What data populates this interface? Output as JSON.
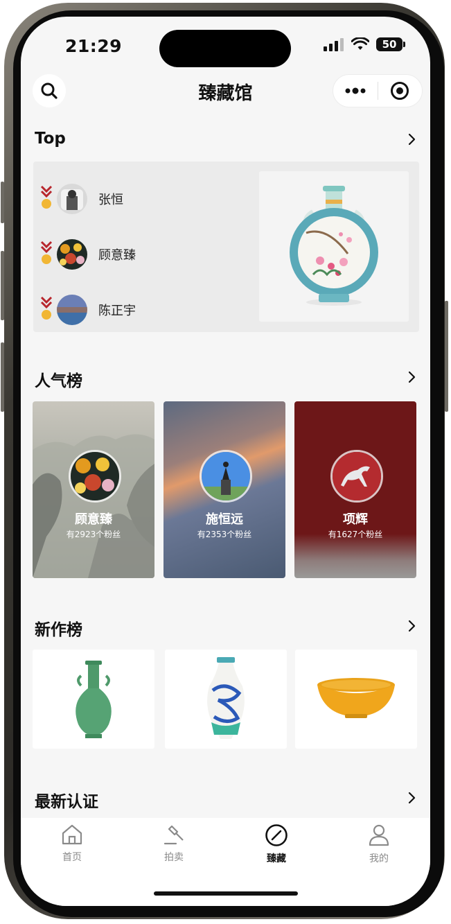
{
  "status_bar": {
    "time": "21:29",
    "battery": "50"
  },
  "navbar": {
    "title": "臻藏馆"
  },
  "top_section": {
    "title": "Top",
    "ranking": [
      {
        "name": "张恒"
      },
      {
        "name": "顾意臻"
      },
      {
        "name": "陈正宇"
      }
    ]
  },
  "popular_section": {
    "title": "人气榜",
    "cards": [
      {
        "name": "顾意臻",
        "fans": "有2923个粉丝"
      },
      {
        "name": "施恒远",
        "fans": "有2353个粉丝"
      },
      {
        "name": "项辉",
        "fans": "有1627个粉丝"
      }
    ]
  },
  "new_works_section": {
    "title": "新作榜"
  },
  "latest_cert_section": {
    "title": "最新认证"
  },
  "tab_bar": {
    "tabs": [
      {
        "label": "首页",
        "icon": "home-icon"
      },
      {
        "label": "拍卖",
        "icon": "gavel-icon"
      },
      {
        "label": "臻藏",
        "icon": "compass-icon",
        "active": true
      },
      {
        "label": "我的",
        "icon": "profile-icon"
      }
    ]
  },
  "colors": {
    "accent_red": "#b8262d",
    "medal_gold": "#f1b634",
    "popular_card_red": "#6d1718"
  }
}
